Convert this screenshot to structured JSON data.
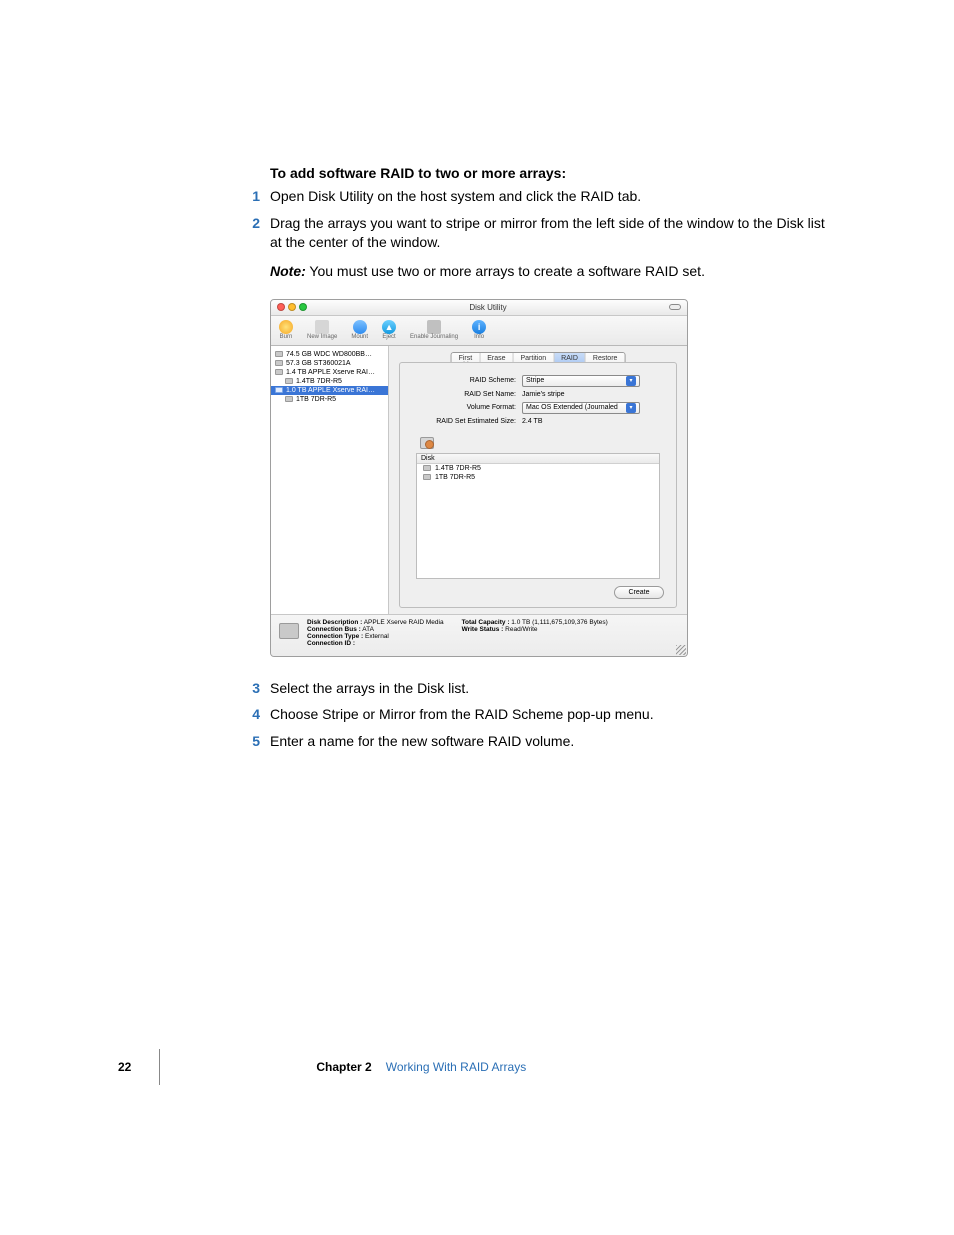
{
  "doc": {
    "heading": "To add software RAID to two or more arrays:",
    "steps_before": [
      "Open Disk Utility on the host system and click the RAID tab.",
      "Drag the arrays you want to stripe or mirror from the left side of the window to the Disk list at the center of the window."
    ],
    "note_label": "Note:",
    "note_text": "  You must use two or more arrays to create a software RAID set.",
    "steps_after": [
      "Select the arrays in the Disk list.",
      "Choose Stripe or Mirror from the RAID Scheme pop-up menu.",
      "Enter a name for the new software RAID volume."
    ],
    "page_number": "22",
    "chapter_label": "Chapter 2",
    "chapter_title": "Working With RAID Arrays"
  },
  "win": {
    "title": "Disk Utility",
    "toolbar": {
      "burn": "Burn",
      "newimage": "New Image",
      "mount": "Mount",
      "eject": "Eject",
      "journal": "Enable Journaling",
      "info": "Info"
    },
    "sidebar": [
      {
        "label": "74.5 GB WDC WD800BB…",
        "indent": false,
        "selected": false
      },
      {
        "label": "57.3 GB ST360021A",
        "indent": false,
        "selected": false
      },
      {
        "label": "1.4 TB APPLE Xserve RAI…",
        "indent": false,
        "selected": false
      },
      {
        "label": "1.4TB 7DR-R5",
        "indent": true,
        "selected": false
      },
      {
        "label": "1.0 TB APPLE Xserve RAI…",
        "indent": false,
        "selected": true
      },
      {
        "label": "1TB 7DR-R5",
        "indent": true,
        "selected": false
      }
    ],
    "tabs": [
      "First Aid",
      "Erase",
      "Partition",
      "RAID",
      "Restore"
    ],
    "active_tab": "RAID",
    "form": {
      "scheme_label": "RAID Scheme:",
      "scheme_value": "Stripe",
      "name_label": "RAID Set Name:",
      "name_value": "Jamie's stripe",
      "format_label": "Volume Format:",
      "format_value": "Mac OS Extended (Journaled",
      "size_label": "RAID Set Estimated Size:",
      "size_value": "2.4 TB"
    },
    "disklist": {
      "header": "Disk",
      "rows": [
        "1.4TB 7DR-R5",
        "1TB 7DR-R5"
      ]
    },
    "create_btn": "Create",
    "footer": {
      "desc_label": "Disk Description :",
      "desc_value": "APPLE Xserve RAID Media",
      "bus_label": "Connection Bus :",
      "bus_value": "ATA",
      "type_label": "Connection Type :",
      "type_value": "External",
      "id_label": "Connection ID :",
      "id_value": "",
      "cap_label": "Total Capacity :",
      "cap_value": "1.0 TB (1,111,675,109,376 Bytes)",
      "ws_label": "Write Status :",
      "ws_value": "Read/Write"
    }
  }
}
